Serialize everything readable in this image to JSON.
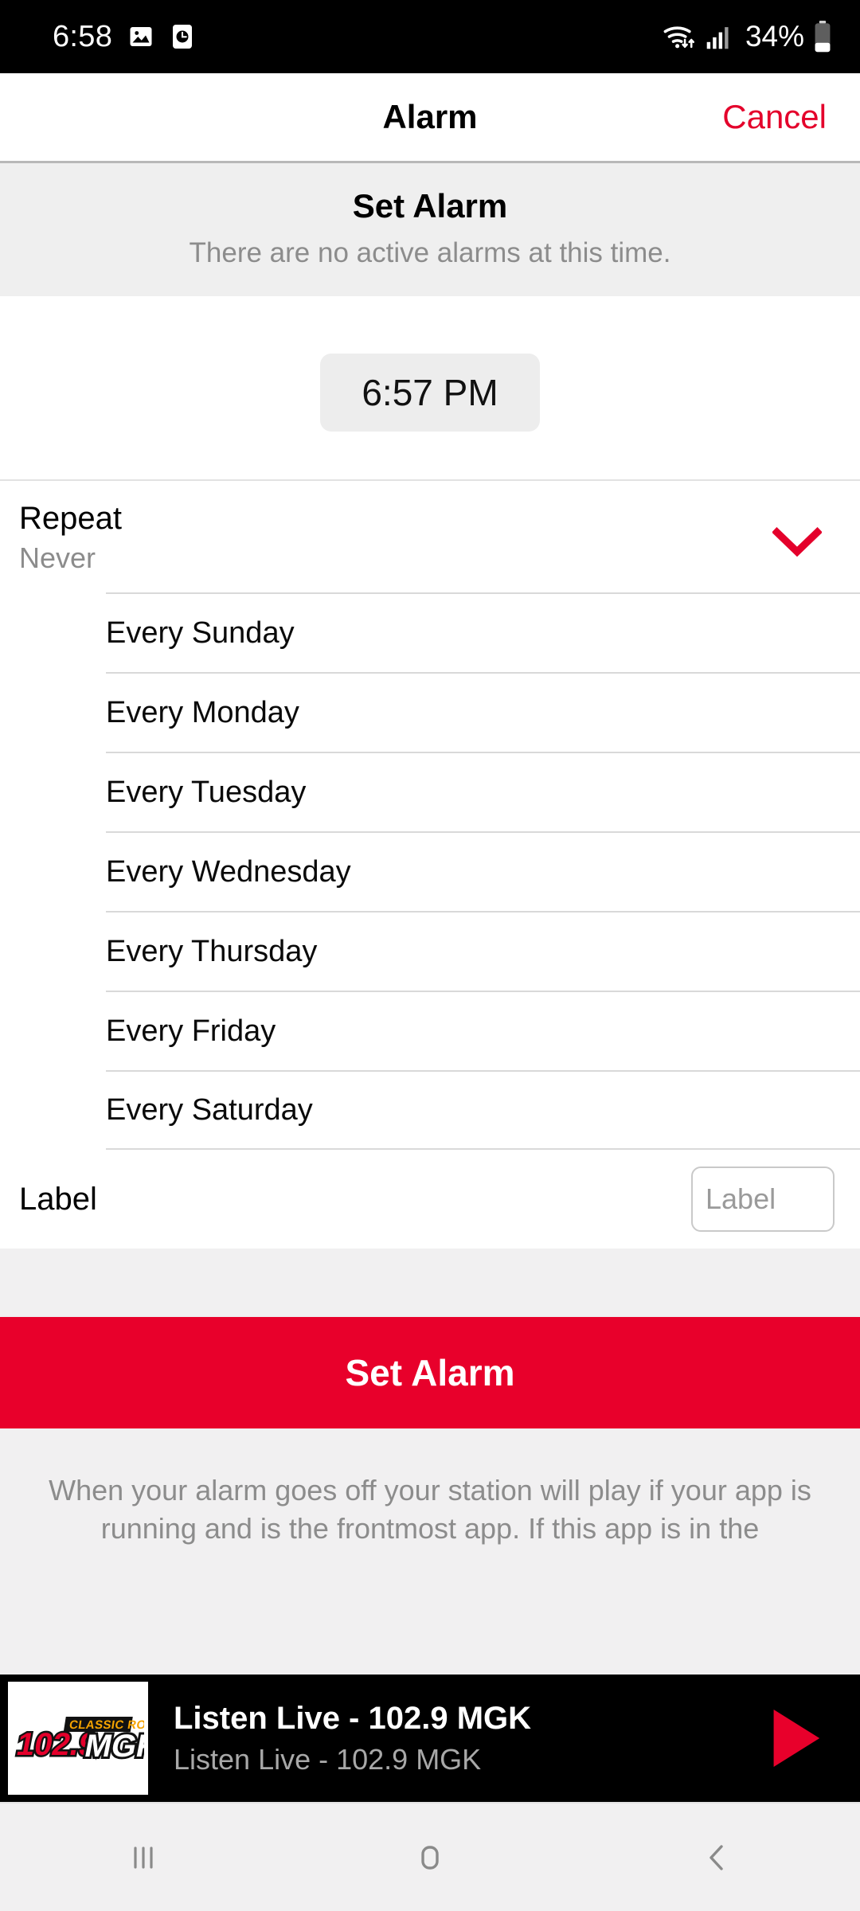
{
  "status_bar": {
    "clock": "6:58",
    "battery_percent": "34%",
    "icons": [
      "image-icon",
      "clock-app-icon",
      "wifi-icon",
      "cellular-signal-icon",
      "battery-icon"
    ]
  },
  "nav_header": {
    "title": "Alarm",
    "cancel_label": "Cancel"
  },
  "banner": {
    "title": "Set Alarm",
    "subtitle": "There are no active alarms at this time."
  },
  "time_picker": {
    "value": "6:57 PM"
  },
  "repeat": {
    "title": "Repeat",
    "value": "Never",
    "expanded": true,
    "options": [
      "Every Sunday",
      "Every Monday",
      "Every Tuesday",
      "Every Wednesday",
      "Every Thursday",
      "Every Friday",
      "Every Saturday"
    ]
  },
  "label_field": {
    "title": "Label",
    "value": "",
    "placeholder": "Label"
  },
  "primary_action": {
    "label": "Set Alarm"
  },
  "footer_note": {
    "text": "When your alarm goes off your station will play if your app is running and is the frontmost app. If this app is in the"
  },
  "player": {
    "title": "Listen Live - 102.9 MGK",
    "subtitle": "Listen Live - 102.9 MGK",
    "artwork_logo": {
      "frequency": "102.9",
      "callsign": "MGK",
      "tagline": "CLASSIC ROCK"
    },
    "play_button": "play-icon"
  },
  "android_nav": {
    "recents": "recents-icon",
    "home": "home-icon",
    "back": "back-icon"
  },
  "colors": {
    "accent_red": "#e4002b",
    "button_red": "#e8002b",
    "banner_gray": "#efefef",
    "page_gray": "#f1f0f1",
    "muted_text": "#8c8c8c",
    "player_bg": "#000000"
  }
}
